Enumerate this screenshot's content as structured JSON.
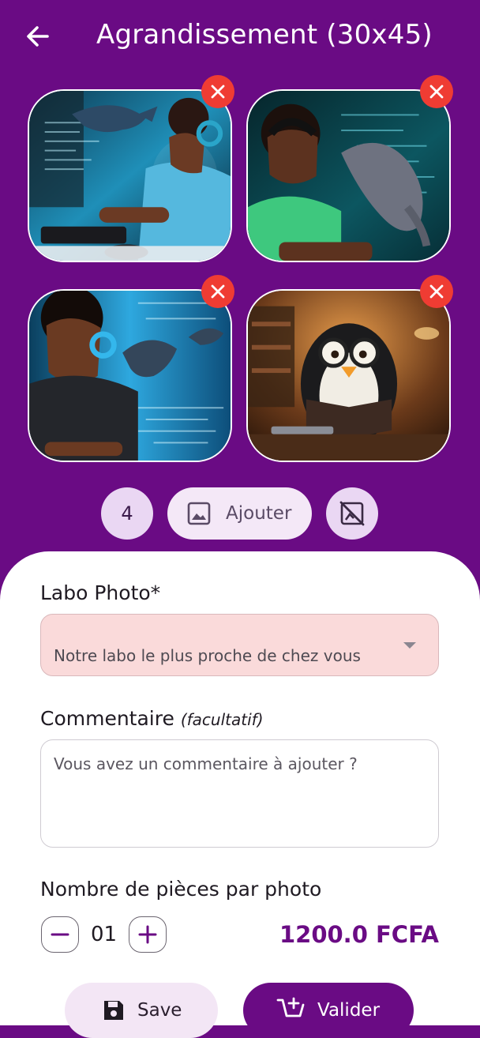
{
  "header": {
    "title": "Agrandissement (30x45)",
    "back_icon": "arrow-left-icon"
  },
  "photos": [
    {
      "alt": "Photo 1",
      "remove_icon": "close-icon"
    },
    {
      "alt": "Photo 2",
      "remove_icon": "close-icon"
    },
    {
      "alt": "Photo 3",
      "remove_icon": "close-icon"
    },
    {
      "alt": "Photo 4",
      "remove_icon": "close-icon"
    }
  ],
  "toolbar": {
    "count": "4",
    "add_label": "Ajouter",
    "add_icon": "image-icon",
    "clear_icon": "hide-image-icon"
  },
  "form": {
    "lab_label": "Labo Photo*",
    "lab_placeholder": "Notre labo le plus proche de chez vous",
    "comment_label": "Commentaire",
    "comment_optional": "(facultatif)",
    "comment_placeholder": "Vous avez un commentaire à ajouter ?",
    "pieces_label": "Nombre de pièces par photo",
    "quantity": "01",
    "price": "1200.0 FCFA"
  },
  "actions": {
    "save_label": "Save",
    "validate_label": "Valider"
  },
  "colors": {
    "primary": "#6a0b84",
    "danger": "#ef3c33",
    "select_bg": "#fadada"
  }
}
